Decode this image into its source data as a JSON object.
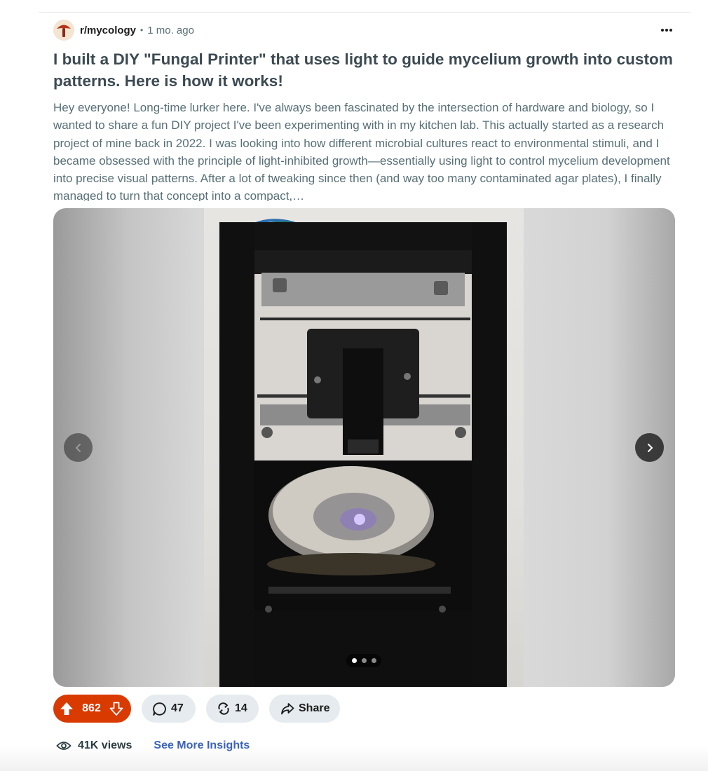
{
  "post": {
    "subreddit": "r/mycology",
    "separator": "•",
    "time": "1 mo. ago",
    "more_icon": "more-horizontal-icon",
    "title": "I built a DIY \"Fungal Printer\" that uses light to guide mycelium growth into custom patterns. Here is how it works!",
    "body": "Hey everyone! Long-time lurker here. I've always been fascinated by the intersection of hardware and biology, so I wanted to share a fun DIY project I've been experimenting with in my kitchen lab. This actually started as a research project of mine back in 2022. I was looking into how different microbial cultures react to environmental stimuli, and I became obsessed with the principle of light-inhibited growth—essentially using light to control mycelium development into precise visual patterns. After a lot of tweaking since then (and way too many contaminated agar plates), I finally managed to turn that concept into a compact,…"
  },
  "gallery": {
    "image_subject": "fungal printer photo",
    "total_slides": 3,
    "active_slide": 1,
    "prev_icon": "chevron-left-icon",
    "next_icon": "chevron-right-icon"
  },
  "actions": {
    "upvotes": "862",
    "comments": "47",
    "reposts": "14",
    "share_label": "Share"
  },
  "insights": {
    "views": "41K views",
    "see_more_label": "See More Insights"
  },
  "colors": {
    "vote_accent": "#d93a00",
    "link": "#3b63b8",
    "pill_bg": "#e5ebee"
  }
}
